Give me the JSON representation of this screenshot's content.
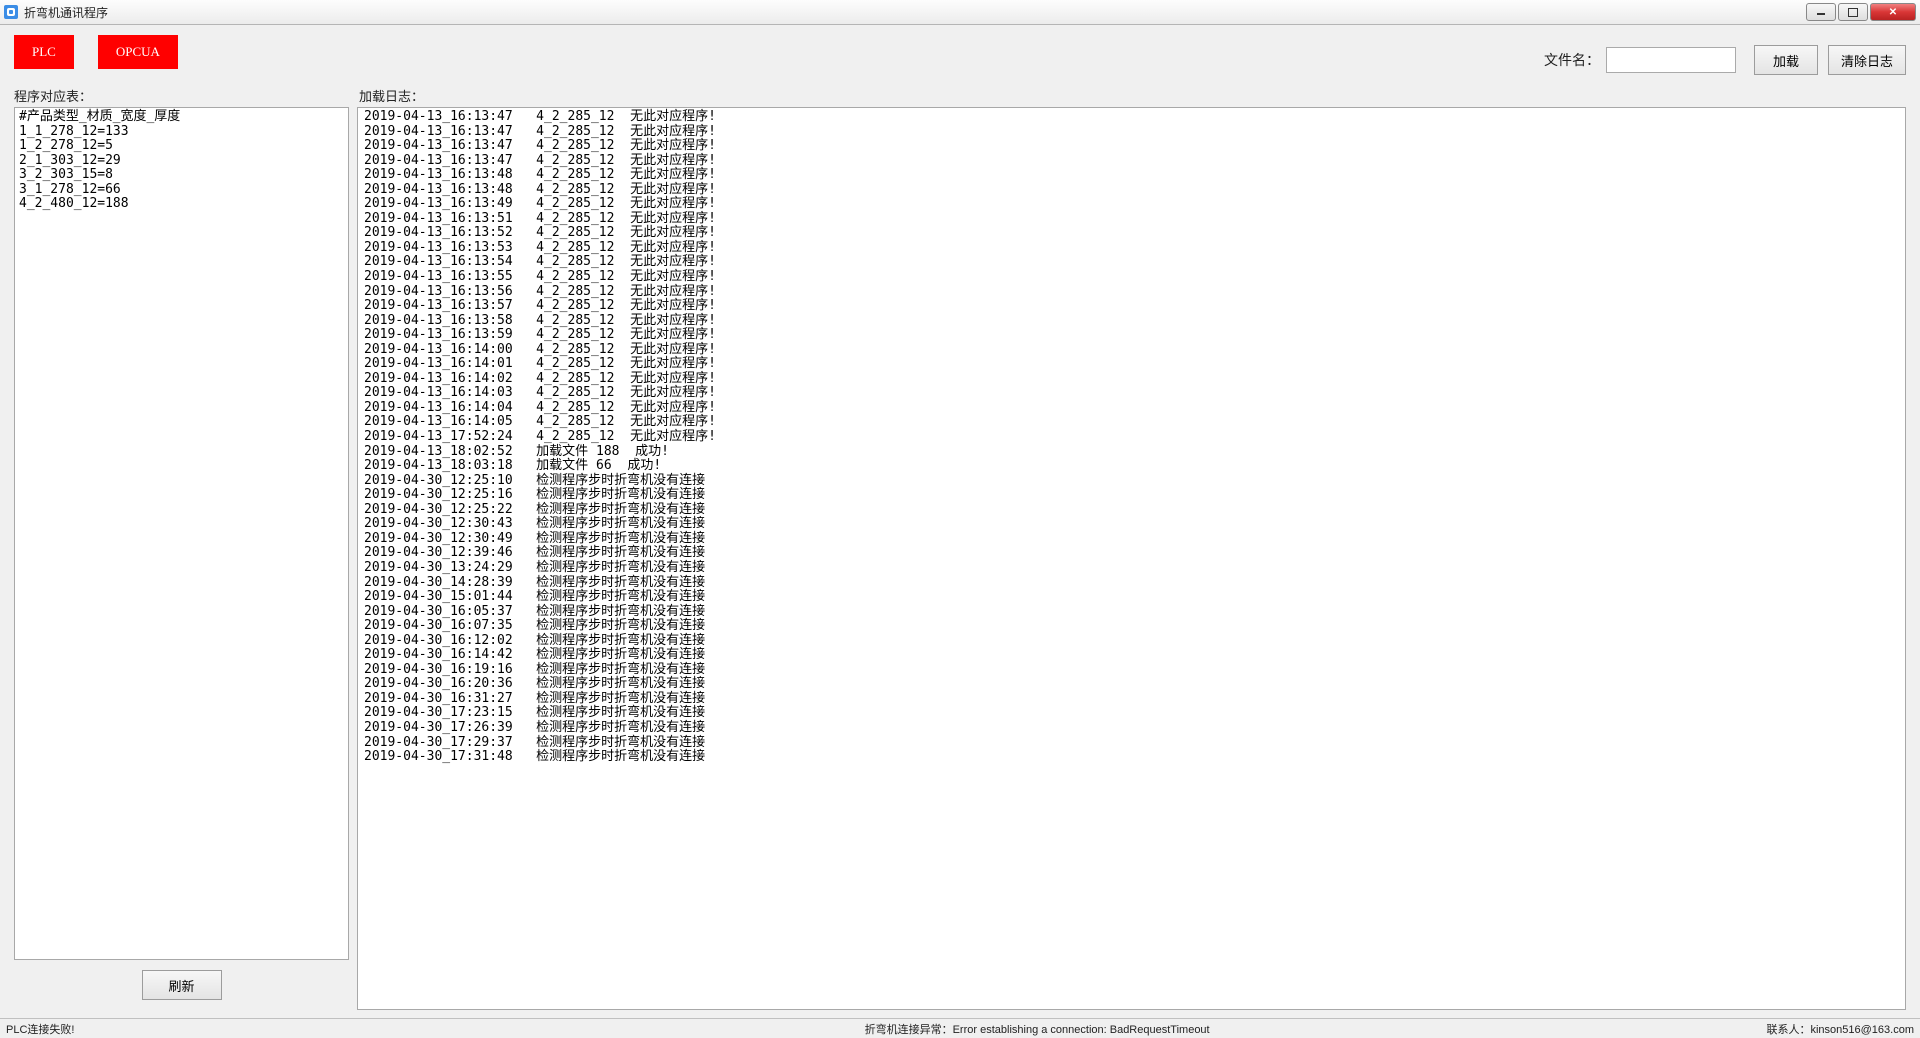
{
  "window": {
    "title": "折弯机通讯程序"
  },
  "toolbar": {
    "plc_label": "PLC",
    "opcua_label": "OPCUA",
    "file_label": "文件名：",
    "file_value": "",
    "load_label": "加载",
    "clear_log_label": "清除日志"
  },
  "left": {
    "title": "程序对应表：",
    "header": "#产品类型_材质_宽度_厚度",
    "rows": [
      "1_1_278_12=133",
      "1_2_278_12=5",
      "2_1_303_12=29",
      "3_2_303_15=8",
      "3_1_278_12=66",
      "4_2_480_12=188"
    ],
    "refresh_label": "刷新"
  },
  "log": {
    "title": "加载日志：",
    "entries": [
      {
        "ts": "2019-04-13_16:13:47",
        "code": "4_2_285_12",
        "msg": "无此对应程序!"
      },
      {
        "ts": "2019-04-13_16:13:47",
        "code": "4_2_285_12",
        "msg": "无此对应程序!"
      },
      {
        "ts": "2019-04-13_16:13:47",
        "code": "4_2_285_12",
        "msg": "无此对应程序!"
      },
      {
        "ts": "2019-04-13_16:13:47",
        "code": "4_2_285_12",
        "msg": "无此对应程序!"
      },
      {
        "ts": "2019-04-13_16:13:48",
        "code": "4_2_285_12",
        "msg": "无此对应程序!"
      },
      {
        "ts": "2019-04-13_16:13:48",
        "code": "4_2_285_12",
        "msg": "无此对应程序!"
      },
      {
        "ts": "2019-04-13_16:13:49",
        "code": "4_2_285_12",
        "msg": "无此对应程序!"
      },
      {
        "ts": "2019-04-13_16:13:51",
        "code": "4_2_285_12",
        "msg": "无此对应程序!"
      },
      {
        "ts": "2019-04-13_16:13:52",
        "code": "4_2_285_12",
        "msg": "无此对应程序!"
      },
      {
        "ts": "2019-04-13_16:13:53",
        "code": "4_2_285_12",
        "msg": "无此对应程序!"
      },
      {
        "ts": "2019-04-13_16:13:54",
        "code": "4_2_285_12",
        "msg": "无此对应程序!"
      },
      {
        "ts": "2019-04-13_16:13:55",
        "code": "4_2_285_12",
        "msg": "无此对应程序!"
      },
      {
        "ts": "2019-04-13_16:13:56",
        "code": "4_2_285_12",
        "msg": "无此对应程序!"
      },
      {
        "ts": "2019-04-13_16:13:57",
        "code": "4_2_285_12",
        "msg": "无此对应程序!"
      },
      {
        "ts": "2019-04-13_16:13:58",
        "code": "4_2_285_12",
        "msg": "无此对应程序!"
      },
      {
        "ts": "2019-04-13_16:13:59",
        "code": "4_2_285_12",
        "msg": "无此对应程序!"
      },
      {
        "ts": "2019-04-13_16:14:00",
        "code": "4_2_285_12",
        "msg": "无此对应程序!"
      },
      {
        "ts": "2019-04-13_16:14:01",
        "code": "4_2_285_12",
        "msg": "无此对应程序!"
      },
      {
        "ts": "2019-04-13_16:14:02",
        "code": "4_2_285_12",
        "msg": "无此对应程序!"
      },
      {
        "ts": "2019-04-13_16:14:03",
        "code": "4_2_285_12",
        "msg": "无此对应程序!"
      },
      {
        "ts": "2019-04-13_16:14:04",
        "code": "4_2_285_12",
        "msg": "无此对应程序!"
      },
      {
        "ts": "2019-04-13_16:14:05",
        "code": "4_2_285_12",
        "msg": "无此对应程序!"
      },
      {
        "ts": "2019-04-13_17:52:24",
        "code": "4_2_285_12",
        "msg": "无此对应程序!"
      },
      {
        "ts": "2019-04-13_18:02:52",
        "code": "",
        "msg": "加载文件 188  成功!"
      },
      {
        "ts": "2019-04-13_18:03:18",
        "code": "",
        "msg": "加载文件 66  成功!"
      },
      {
        "ts": "2019-04-30_12:25:10",
        "code": "",
        "msg": "检测程序步时折弯机没有连接"
      },
      {
        "ts": "2019-04-30_12:25:16",
        "code": "",
        "msg": "检测程序步时折弯机没有连接"
      },
      {
        "ts": "2019-04-30_12:25:22",
        "code": "",
        "msg": "检测程序步时折弯机没有连接"
      },
      {
        "ts": "2019-04-30_12:30:43",
        "code": "",
        "msg": "检测程序步时折弯机没有连接"
      },
      {
        "ts": "2019-04-30_12:30:49",
        "code": "",
        "msg": "检测程序步时折弯机没有连接"
      },
      {
        "ts": "2019-04-30_12:39:46",
        "code": "",
        "msg": "检测程序步时折弯机没有连接"
      },
      {
        "ts": "2019-04-30_13:24:29",
        "code": "",
        "msg": "检测程序步时折弯机没有连接"
      },
      {
        "ts": "2019-04-30_14:28:39",
        "code": "",
        "msg": "检测程序步时折弯机没有连接"
      },
      {
        "ts": "2019-04-30_15:01:44",
        "code": "",
        "msg": "检测程序步时折弯机没有连接"
      },
      {
        "ts": "2019-04-30_16:05:37",
        "code": "",
        "msg": "检测程序步时折弯机没有连接"
      },
      {
        "ts": "2019-04-30_16:07:35",
        "code": "",
        "msg": "检测程序步时折弯机没有连接"
      },
      {
        "ts": "2019-04-30_16:12:02",
        "code": "",
        "msg": "检测程序步时折弯机没有连接"
      },
      {
        "ts": "2019-04-30_16:14:42",
        "code": "",
        "msg": "检测程序步时折弯机没有连接"
      },
      {
        "ts": "2019-04-30_16:19:16",
        "code": "",
        "msg": "检测程序步时折弯机没有连接"
      },
      {
        "ts": "2019-04-30_16:20:36",
        "code": "",
        "msg": "检测程序步时折弯机没有连接"
      },
      {
        "ts": "2019-04-30_16:31:27",
        "code": "",
        "msg": "检测程序步时折弯机没有连接"
      },
      {
        "ts": "2019-04-30_17:23:15",
        "code": "",
        "msg": "检测程序步时折弯机没有连接"
      },
      {
        "ts": "2019-04-30_17:26:39",
        "code": "",
        "msg": "检测程序步时折弯机没有连接"
      },
      {
        "ts": "2019-04-30_17:29:37",
        "code": "",
        "msg": "检测程序步时折弯机没有连接"
      },
      {
        "ts": "2019-04-30_17:31:48",
        "code": "",
        "msg": "检测程序步时折弯机没有连接"
      }
    ]
  },
  "status": {
    "left": "PLC连接失败!",
    "mid": "折弯机连接异常：Error establishing a connection: BadRequestTimeout",
    "right": "联系人：kinson516@163.com"
  },
  "colors": {
    "accent_red": "#ff0000",
    "window_border": "#b5b5b5",
    "client_bg": "#f0f0f0"
  }
}
